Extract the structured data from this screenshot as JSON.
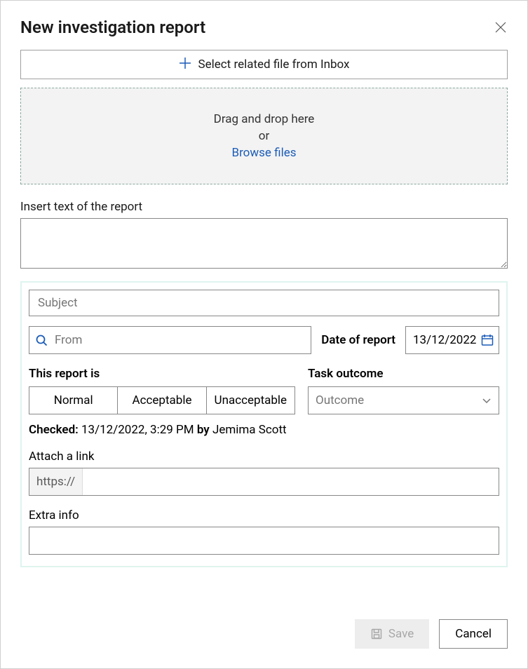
{
  "header": {
    "title": "New investigation report"
  },
  "selectFile": {
    "label": "Select related file from Inbox"
  },
  "dropzone": {
    "line1": "Drag and drop here",
    "or": "or",
    "browse": "Browse files"
  },
  "reportText": {
    "label": "Insert text of the report"
  },
  "subject": {
    "placeholder": "Subject"
  },
  "from": {
    "placeholder": "From"
  },
  "dateOfReport": {
    "label": "Date of report",
    "value": "13/12/2022"
  },
  "reportIs": {
    "label": "This report is",
    "options": [
      "Normal",
      "Acceptable",
      "Unacceptable"
    ]
  },
  "taskOutcome": {
    "label": "Task outcome",
    "placeholder": "Outcome"
  },
  "checked": {
    "checkedLabel": "Checked:",
    "datetime": "13/12/2022, 3:29 PM",
    "byLabel": "by",
    "person": "Jemima Scott"
  },
  "attachLink": {
    "label": "Attach a link",
    "prefix": "https://"
  },
  "extraInfo": {
    "label": "Extra info"
  },
  "footer": {
    "save": "Save",
    "cancel": "Cancel"
  }
}
